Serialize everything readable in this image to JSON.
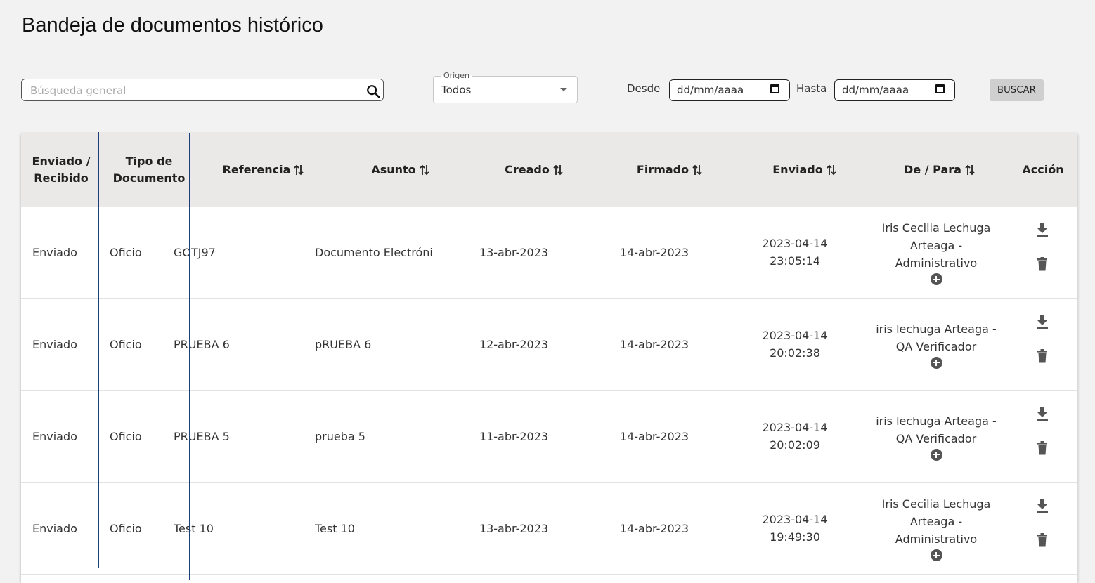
{
  "page": {
    "title": "Bandeja de documentos histórico"
  },
  "filters": {
    "search_placeholder": "Búsqueda general",
    "origin_label": "Origen",
    "origin_value": "Todos",
    "from_label": "Desde",
    "to_label": "Hasta",
    "date_placeholder": "dd/mm/aaaa",
    "search_button": "BUSCAR"
  },
  "table": {
    "headers": {
      "direction": "Enviado / Recibido",
      "doc_type": "Tipo de Documento",
      "reference": "Referencia",
      "subject": "Asunto",
      "created": "Creado",
      "signed": "Firmado",
      "sent": "Enviado",
      "from_to": "De / Para",
      "action": "Acción"
    },
    "rows": [
      {
        "direction": "Enviado",
        "doc_type": "Oficio",
        "reference": "GOTJ97",
        "subject": "Documento Electrónico",
        "created": "13-abr-2023",
        "signed": "14-abr-2023",
        "sent": "2023-04-14 23:05:14",
        "from_to": "Iris Cecilia Lechuga Arteaga - Administrativo"
      },
      {
        "direction": "Enviado",
        "doc_type": "Oficio",
        "reference": "PRUEBA 6",
        "subject": "pRUEBA 6",
        "created": "12-abr-2023",
        "signed": "14-abr-2023",
        "sent": "2023-04-14 20:02:38",
        "from_to": "iris lechuga Arteaga - QA Verificador"
      },
      {
        "direction": "Enviado",
        "doc_type": "Oficio",
        "reference": "PRUEBA 5",
        "subject": "prueba 5",
        "created": "11-abr-2023",
        "signed": "14-abr-2023",
        "sent": "2023-04-14 20:02:09",
        "from_to": "iris lechuga Arteaga - QA Verificador"
      },
      {
        "direction": "Enviado",
        "doc_type": "Oficio",
        "reference": "Test 10",
        "subject": "Test 10",
        "created": "13-abr-2023",
        "signed": "14-abr-2023",
        "sent": "2023-04-14 19:49:30",
        "from_to": "Iris Cecilia Lechuga Arteaga - Administrativo"
      }
    ]
  }
}
